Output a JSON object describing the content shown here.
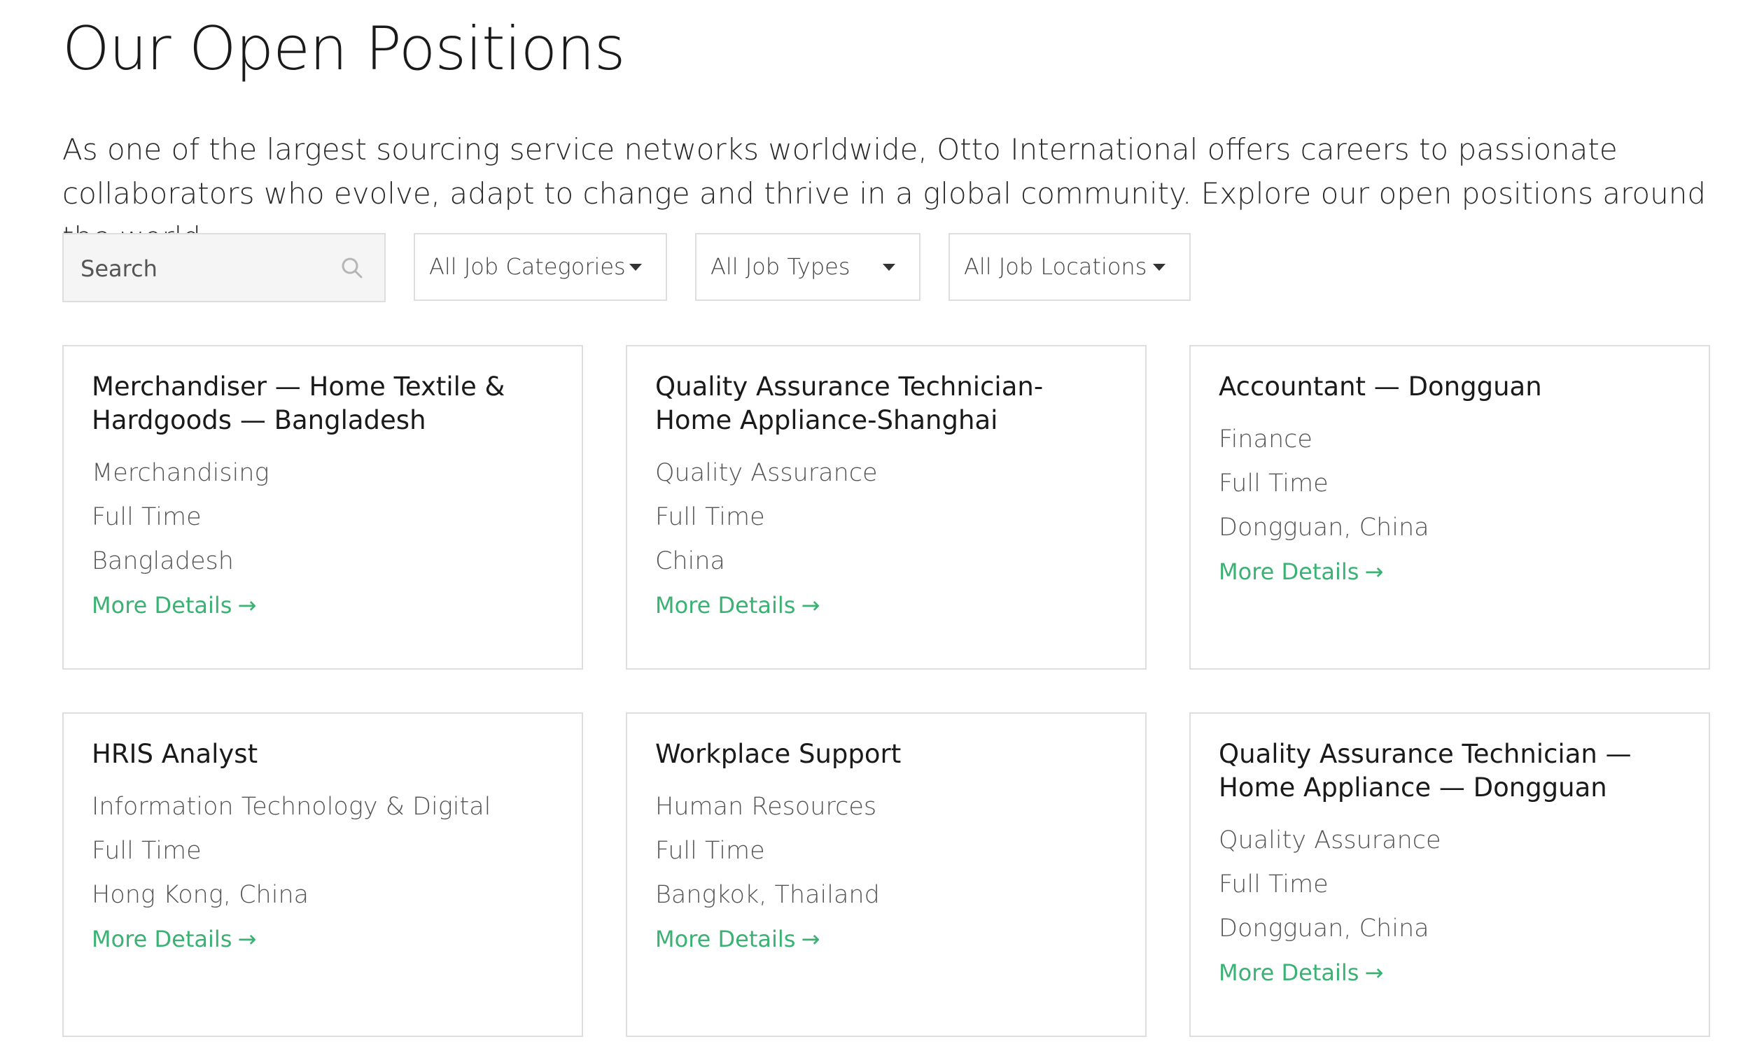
{
  "header": {
    "title": "Our Open Positions",
    "intro": "As one of the largest sourcing service networks worldwide, Otto International offers careers to passionate collaborators who evolve, adapt to change and thrive in a global community. Explore our open positions around the world."
  },
  "filters": {
    "search_placeholder": "Search",
    "search_icon": "search-icon",
    "categories": "All Job Categories",
    "types": "All Job Types",
    "locations": "All Job Locations",
    "dropdown_icon": "caret-down-icon"
  },
  "colors": {
    "accent": "#3bb273",
    "border": "#dedede",
    "search_bg": "#f5f5f5"
  },
  "jobs": [
    {
      "title": "Merchandiser — Home Textile & Hardgoods — Bangladesh",
      "category": "Merchandising",
      "type": "Full Time",
      "location": "Bangladesh",
      "link": "More Details",
      "link_arrow": "→"
    },
    {
      "title": "Quality Assurance Technician- Home Appliance-Shanghai",
      "category": "Quality Assurance",
      "type": "Full Time",
      "location": "China",
      "link": "More Details",
      "link_arrow": "→"
    },
    {
      "title": "Accountant — Dongguan",
      "category": "Finance",
      "type": "Full Time",
      "location": "Dongguan, China",
      "link": "More Details",
      "link_arrow": "→"
    },
    {
      "title": "HRIS Analyst",
      "category": "Information Technology & Digital",
      "type": "Full Time",
      "location": "Hong Kong, China",
      "link": "More Details",
      "link_arrow": "→"
    },
    {
      "title": "Workplace Support",
      "category": "Human Resources",
      "type": "Full Time",
      "location": "Bangkok, Thailand",
      "link": "More Details",
      "link_arrow": "→"
    },
    {
      "title": "Quality Assurance Technician — Home Appliance — Dongguan",
      "category": "Quality Assurance",
      "type": "Full Time",
      "location": "Dongguan, China",
      "link": "More Details",
      "link_arrow": "→"
    }
  ]
}
